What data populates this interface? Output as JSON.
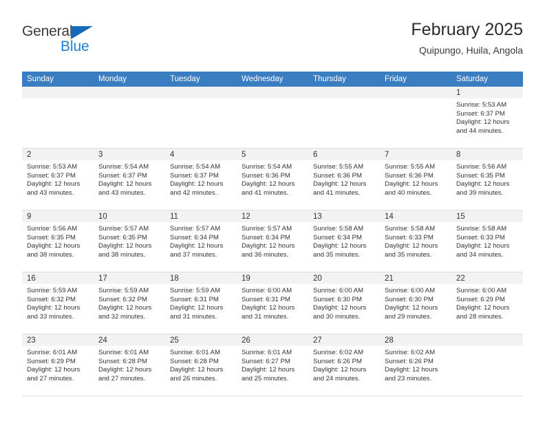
{
  "brand": {
    "name_top": "General",
    "name_bottom": "Blue"
  },
  "header": {
    "title": "February 2025",
    "subtitle": "Quipungo, Huila, Angola"
  },
  "colors": {
    "header_blue": "#3a7ec1",
    "logo_blue": "#1a7fd4",
    "daynum_band": "#f2f2f2"
  },
  "weekdays": [
    "Sunday",
    "Monday",
    "Tuesday",
    "Wednesday",
    "Thursday",
    "Friday",
    "Saturday"
  ],
  "labels": {
    "sunrise": "Sunrise:",
    "sunset": "Sunset:",
    "daylight": "Daylight:"
  },
  "weeks": [
    [
      {
        "day": "",
        "empty": true
      },
      {
        "day": "",
        "empty": true
      },
      {
        "day": "",
        "empty": true
      },
      {
        "day": "",
        "empty": true
      },
      {
        "day": "",
        "empty": true
      },
      {
        "day": "",
        "empty": true
      },
      {
        "day": "1",
        "sunrise": "Sunrise: 5:53 AM",
        "sunset": "Sunset: 6:37 PM",
        "daylight": "Daylight: 12 hours and 44 minutes."
      }
    ],
    [
      {
        "day": "2",
        "sunrise": "Sunrise: 5:53 AM",
        "sunset": "Sunset: 6:37 PM",
        "daylight": "Daylight: 12 hours and 43 minutes."
      },
      {
        "day": "3",
        "sunrise": "Sunrise: 5:54 AM",
        "sunset": "Sunset: 6:37 PM",
        "daylight": "Daylight: 12 hours and 43 minutes."
      },
      {
        "day": "4",
        "sunrise": "Sunrise: 5:54 AM",
        "sunset": "Sunset: 6:37 PM",
        "daylight": "Daylight: 12 hours and 42 minutes."
      },
      {
        "day": "5",
        "sunrise": "Sunrise: 5:54 AM",
        "sunset": "Sunset: 6:36 PM",
        "daylight": "Daylight: 12 hours and 41 minutes."
      },
      {
        "day": "6",
        "sunrise": "Sunrise: 5:55 AM",
        "sunset": "Sunset: 6:36 PM",
        "daylight": "Daylight: 12 hours and 41 minutes."
      },
      {
        "day": "7",
        "sunrise": "Sunrise: 5:55 AM",
        "sunset": "Sunset: 6:36 PM",
        "daylight": "Daylight: 12 hours and 40 minutes."
      },
      {
        "day": "8",
        "sunrise": "Sunrise: 5:56 AM",
        "sunset": "Sunset: 6:35 PM",
        "daylight": "Daylight: 12 hours and 39 minutes."
      }
    ],
    [
      {
        "day": "9",
        "sunrise": "Sunrise: 5:56 AM",
        "sunset": "Sunset: 6:35 PM",
        "daylight": "Daylight: 12 hours and 38 minutes."
      },
      {
        "day": "10",
        "sunrise": "Sunrise: 5:57 AM",
        "sunset": "Sunset: 6:35 PM",
        "daylight": "Daylight: 12 hours and 38 minutes."
      },
      {
        "day": "11",
        "sunrise": "Sunrise: 5:57 AM",
        "sunset": "Sunset: 6:34 PM",
        "daylight": "Daylight: 12 hours and 37 minutes."
      },
      {
        "day": "12",
        "sunrise": "Sunrise: 5:57 AM",
        "sunset": "Sunset: 6:34 PM",
        "daylight": "Daylight: 12 hours and 36 minutes."
      },
      {
        "day": "13",
        "sunrise": "Sunrise: 5:58 AM",
        "sunset": "Sunset: 6:34 PM",
        "daylight": "Daylight: 12 hours and 35 minutes."
      },
      {
        "day": "14",
        "sunrise": "Sunrise: 5:58 AM",
        "sunset": "Sunset: 6:33 PM",
        "daylight": "Daylight: 12 hours and 35 minutes."
      },
      {
        "day": "15",
        "sunrise": "Sunrise: 5:58 AM",
        "sunset": "Sunset: 6:33 PM",
        "daylight": "Daylight: 12 hours and 34 minutes."
      }
    ],
    [
      {
        "day": "16",
        "sunrise": "Sunrise: 5:59 AM",
        "sunset": "Sunset: 6:32 PM",
        "daylight": "Daylight: 12 hours and 33 minutes."
      },
      {
        "day": "17",
        "sunrise": "Sunrise: 5:59 AM",
        "sunset": "Sunset: 6:32 PM",
        "daylight": "Daylight: 12 hours and 32 minutes."
      },
      {
        "day": "18",
        "sunrise": "Sunrise: 5:59 AM",
        "sunset": "Sunset: 6:31 PM",
        "daylight": "Daylight: 12 hours and 31 minutes."
      },
      {
        "day": "19",
        "sunrise": "Sunrise: 6:00 AM",
        "sunset": "Sunset: 6:31 PM",
        "daylight": "Daylight: 12 hours and 31 minutes."
      },
      {
        "day": "20",
        "sunrise": "Sunrise: 6:00 AM",
        "sunset": "Sunset: 6:30 PM",
        "daylight": "Daylight: 12 hours and 30 minutes."
      },
      {
        "day": "21",
        "sunrise": "Sunrise: 6:00 AM",
        "sunset": "Sunset: 6:30 PM",
        "daylight": "Daylight: 12 hours and 29 minutes."
      },
      {
        "day": "22",
        "sunrise": "Sunrise: 6:00 AM",
        "sunset": "Sunset: 6:29 PM",
        "daylight": "Daylight: 12 hours and 28 minutes."
      }
    ],
    [
      {
        "day": "23",
        "sunrise": "Sunrise: 6:01 AM",
        "sunset": "Sunset: 6:29 PM",
        "daylight": "Daylight: 12 hours and 27 minutes."
      },
      {
        "day": "24",
        "sunrise": "Sunrise: 6:01 AM",
        "sunset": "Sunset: 6:28 PM",
        "daylight": "Daylight: 12 hours and 27 minutes."
      },
      {
        "day": "25",
        "sunrise": "Sunrise: 6:01 AM",
        "sunset": "Sunset: 6:28 PM",
        "daylight": "Daylight: 12 hours and 26 minutes."
      },
      {
        "day": "26",
        "sunrise": "Sunrise: 6:01 AM",
        "sunset": "Sunset: 6:27 PM",
        "daylight": "Daylight: 12 hours and 25 minutes."
      },
      {
        "day": "27",
        "sunrise": "Sunrise: 6:02 AM",
        "sunset": "Sunset: 6:26 PM",
        "daylight": "Daylight: 12 hours and 24 minutes."
      },
      {
        "day": "28",
        "sunrise": "Sunrise: 6:02 AM",
        "sunset": "Sunset: 6:26 PM",
        "daylight": "Daylight: 12 hours and 23 minutes."
      },
      {
        "day": "",
        "empty": true
      }
    ]
  ]
}
